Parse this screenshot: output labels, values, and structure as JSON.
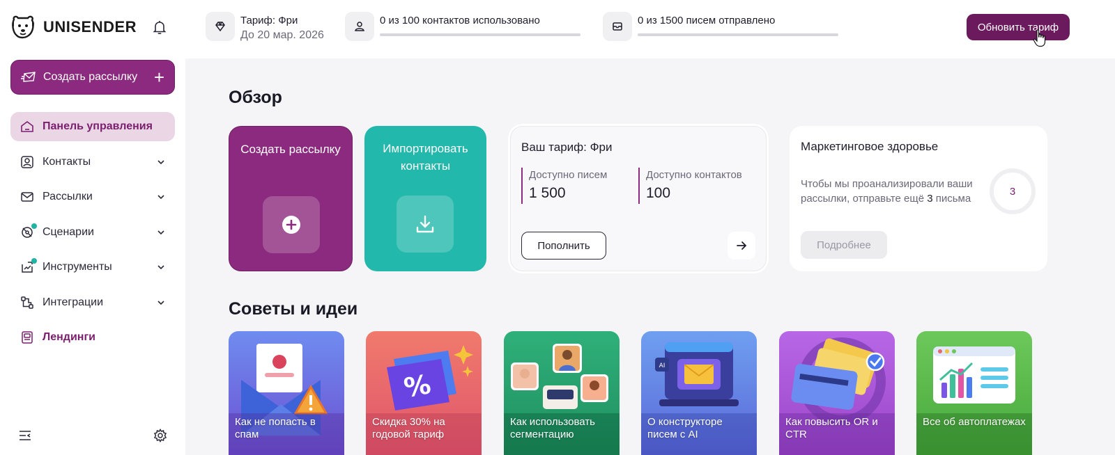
{
  "app": {
    "brand": "UNISENDER"
  },
  "sidebar": {
    "create_button": "Создать рассылку",
    "items": [
      {
        "label": "Панель управления",
        "icon": "home-icon"
      },
      {
        "label": "Контакты",
        "icon": "contacts-icon"
      },
      {
        "label": "Рассылки",
        "icon": "mail-icon"
      },
      {
        "label": "Сценарии",
        "icon": "scenario-icon"
      },
      {
        "label": "Инструменты",
        "icon": "tools-icon"
      },
      {
        "label": "Интеграции",
        "icon": "integrations-icon"
      },
      {
        "label": "Лендинги",
        "icon": "landing-icon"
      }
    ]
  },
  "topbar": {
    "tariff_label": "Тариф: Фри",
    "tariff_until": "До 20 мар. 2026",
    "contacts_used": "0 из 100 контактов использовано",
    "contacts_progress": 0,
    "emails_sent": "0 из 1500 писем отправлено",
    "emails_progress": 0,
    "upgrade_button": "Обновить тариф"
  },
  "main": {
    "overview_title": "Обзор",
    "create_card": "Создать рассылку",
    "import_card": "Импортировать контакты",
    "tariff_card": {
      "title": "Ваш тариф: Фри",
      "emails_label": "Доступно писем",
      "emails_value": "1 500",
      "contacts_label": "Доступно контактов",
      "contacts_value": "100",
      "topup_button": "Пополнить"
    },
    "health_card": {
      "title": "Маркетинговое здоровье",
      "desc_before": "Чтобы мы проанализировали ваши рассылки, отправьте ещё ",
      "desc_count": "3",
      "desc_after": " письма",
      "score": "3",
      "more_button": "Подробнее"
    },
    "tips_title": "Советы и идеи",
    "tips": [
      {
        "caption": "Как не попасть в спам",
        "color": "#6c63d6"
      },
      {
        "caption": "Скидка 30% на годовой тариф",
        "color": "#e8655f"
      },
      {
        "caption": "Как использовать сегментацию",
        "color": "#23a36c"
      },
      {
        "caption": "О конструкторе писем с AI",
        "color": "#5f86e0"
      },
      {
        "caption": "Как повысить OR и CTR",
        "color": "#a64fd4"
      },
      {
        "caption": "Все об автоплатежах",
        "color": "#5bb84a"
      }
    ]
  },
  "colors": {
    "brand": "#8b2a7e",
    "brand_dark": "#6b1a5e",
    "teal": "#23b8ac",
    "active_bg": "#ebd6e6"
  }
}
